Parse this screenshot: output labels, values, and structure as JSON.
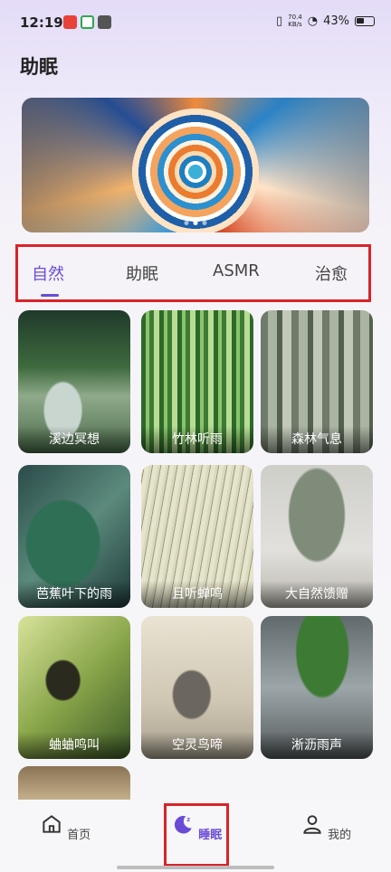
{
  "status": {
    "time": "12:19",
    "net_speed_value": "70.4",
    "net_speed_unit": "KB/s",
    "battery": "43%"
  },
  "page": {
    "title": "助眠"
  },
  "tabs": [
    {
      "label": "自然",
      "active": true
    },
    {
      "label": "助眠",
      "active": false
    },
    {
      "label": "ASMR",
      "active": false
    },
    {
      "label": "治愈",
      "active": false
    }
  ],
  "cards": [
    {
      "label": "溪边冥想"
    },
    {
      "label": "竹林听雨"
    },
    {
      "label": "森林气息"
    },
    {
      "label": "芭蕉叶下的雨"
    },
    {
      "label": "且听蝉鸣"
    },
    {
      "label": "大自然馈赠"
    },
    {
      "label": "蛐蛐鸣叫"
    },
    {
      "label": "空灵鸟啼"
    },
    {
      "label": "淅沥雨声"
    }
  ],
  "nav": {
    "home": {
      "label": "首页",
      "icon": "home-icon"
    },
    "sleep": {
      "label": "睡眠",
      "icon": "moon-icon"
    },
    "me": {
      "label": "我的",
      "icon": "user-icon"
    }
  },
  "colors": {
    "accent": "#6a4bd6",
    "highlight_box": "#d9232a"
  }
}
